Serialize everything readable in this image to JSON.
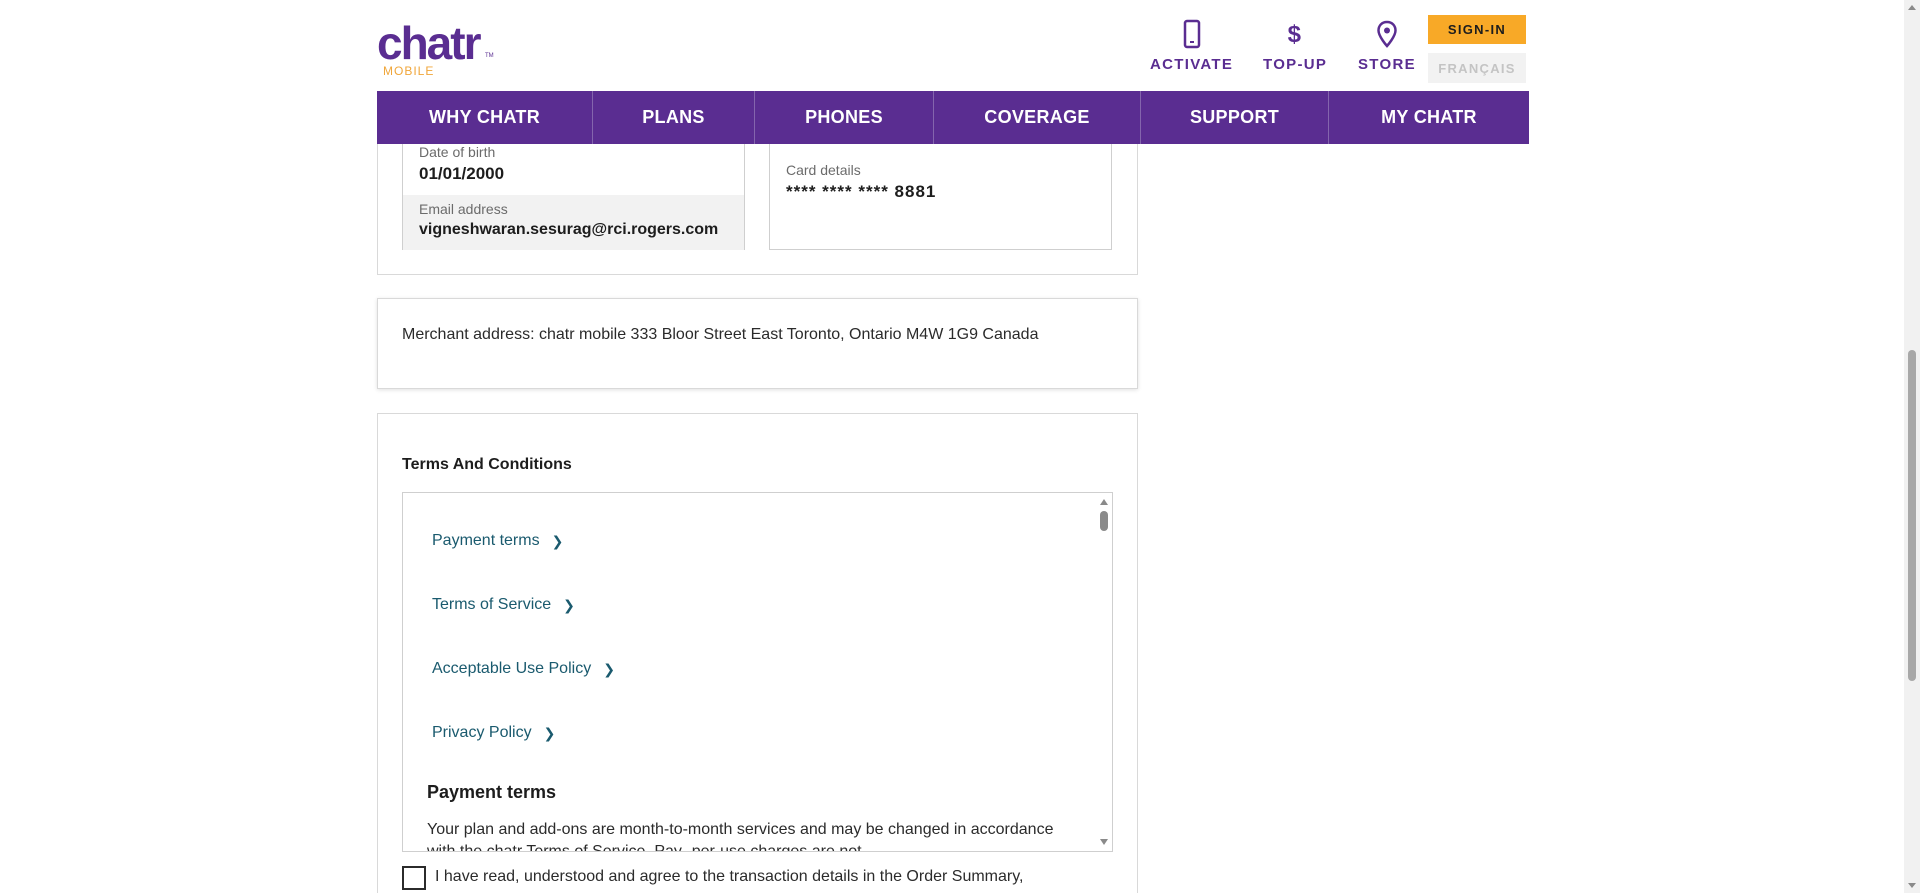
{
  "brand": {
    "word": "chatr",
    "tm": "TM",
    "sub": "MOBILE"
  },
  "header": {
    "utilities": [
      {
        "label": "ACTIVATE",
        "icon": "phone-icon"
      },
      {
        "label": "TOP-UP",
        "icon": "dollar-icon"
      },
      {
        "label": "STORE",
        "icon": "location-pin-icon"
      }
    ],
    "signin_label": "SIGN-IN",
    "language_label": "FRANÇAIS"
  },
  "nav": {
    "items": [
      "WHY CHATR",
      "PLANS",
      "PHONES",
      "COVERAGE",
      "SUPPORT",
      "MY CHATR"
    ]
  },
  "customer": {
    "dob_label": "Date of birth",
    "dob_value": "01/01/2000",
    "email_label": "Email address",
    "email_value": "vigneshwaran.sesurag@rci.rogers.com"
  },
  "payment": {
    "card_label": "Card details",
    "card_value": "**** **** **** 8881"
  },
  "merchant": {
    "text": "Merchant address: chatr mobile 333 Bloor Street East Toronto, Ontario M4W 1G9 Canada"
  },
  "terms": {
    "title": "Terms And Conditions",
    "links": [
      "Payment terms",
      "Terms of Service",
      "Acceptable Use Policy",
      "Privacy Policy"
    ],
    "section_heading": "Payment terms",
    "section_text": "Your plan and add-ons are month-to-month services and may be changed in accordance with the chatr Terms of Service. Pay- per-use charges are not"
  },
  "agreement": {
    "text": "I have read, understood and agree to the transaction details in the Order Summary,"
  },
  "colors": {
    "brand_purple": "#5a2d91",
    "signin_yellow": "#f8a927",
    "link_teal": "#1a5a6e"
  }
}
